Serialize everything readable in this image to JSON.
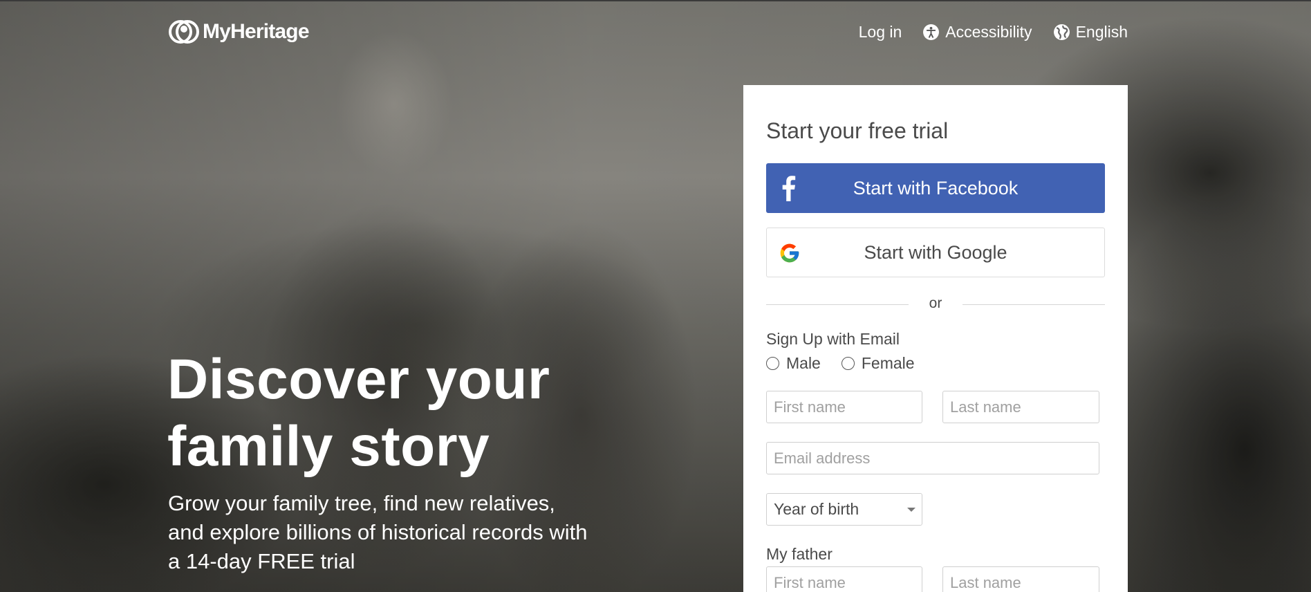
{
  "brand": {
    "logo_text": "MyHeritage"
  },
  "nav": {
    "login": "Log in",
    "accessibility": "Accessibility",
    "language": "English"
  },
  "hero": {
    "headline_line1": "Discover your",
    "headline_line2": "family story",
    "subtext_line1": "Grow your family tree, find new relatives,",
    "subtext_line2": "and explore billions of historical records with",
    "subtext_line3": "a 14-day FREE trial"
  },
  "signup": {
    "title": "Start your free trial",
    "facebook_button": "Start with Facebook",
    "google_button": "Start with Google",
    "divider": "or",
    "email_section_label": "Sign Up with Email",
    "gender_options": [
      "Male",
      "Female"
    ],
    "first_name_placeholder": "First name",
    "last_name_placeholder": "Last name",
    "email_placeholder": "Email address",
    "year_of_birth": "Year of birth",
    "father_label": "My father",
    "father_first_name_placeholder": "First name",
    "father_last_name_placeholder": "Last name"
  },
  "colors": {
    "facebook_blue": "#4162b3",
    "panel_bg": "#ffffff",
    "text_dark": "#4a4a4a"
  },
  "icons": {
    "logo": "myheritage-logo-icon",
    "accessibility": "accessibility-icon",
    "language": "globe-icon",
    "facebook": "facebook-icon",
    "google": "google-icon",
    "select_caret": "caret-down-icon"
  }
}
